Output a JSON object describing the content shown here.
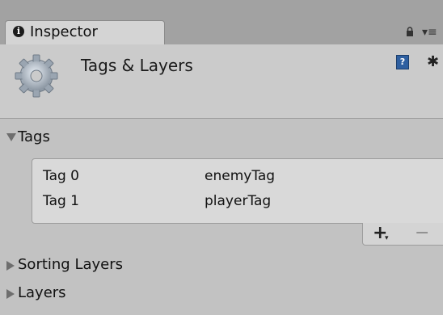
{
  "tab": {
    "title": "Inspector",
    "info_glyph": "i"
  },
  "window_controls": {
    "lock_icon": "lock-icon",
    "menu_glyph": "▾≡"
  },
  "header": {
    "title": "Tags & Layers",
    "help_glyph": "?",
    "settings_glyph": "✱"
  },
  "sections": {
    "tags": {
      "label": "Tags",
      "expanded": true,
      "items": [
        {
          "name": "Tag 0",
          "value": "enemyTag"
        },
        {
          "name": "Tag 1",
          "value": "playerTag"
        }
      ],
      "add_label": "+",
      "add_caret": "▾",
      "remove_label": "−"
    },
    "sorting_layers": {
      "label": "Sorting Layers",
      "expanded": false
    },
    "layers": {
      "label": "Layers",
      "expanded": false
    }
  },
  "colors": {
    "panel_bg": "#c2c2c2",
    "tabbar_bg": "#a2a2a2",
    "header_bg": "#cbcbcb",
    "list_bg": "#d9d9d9",
    "accent_help": "#2e5fa0"
  }
}
